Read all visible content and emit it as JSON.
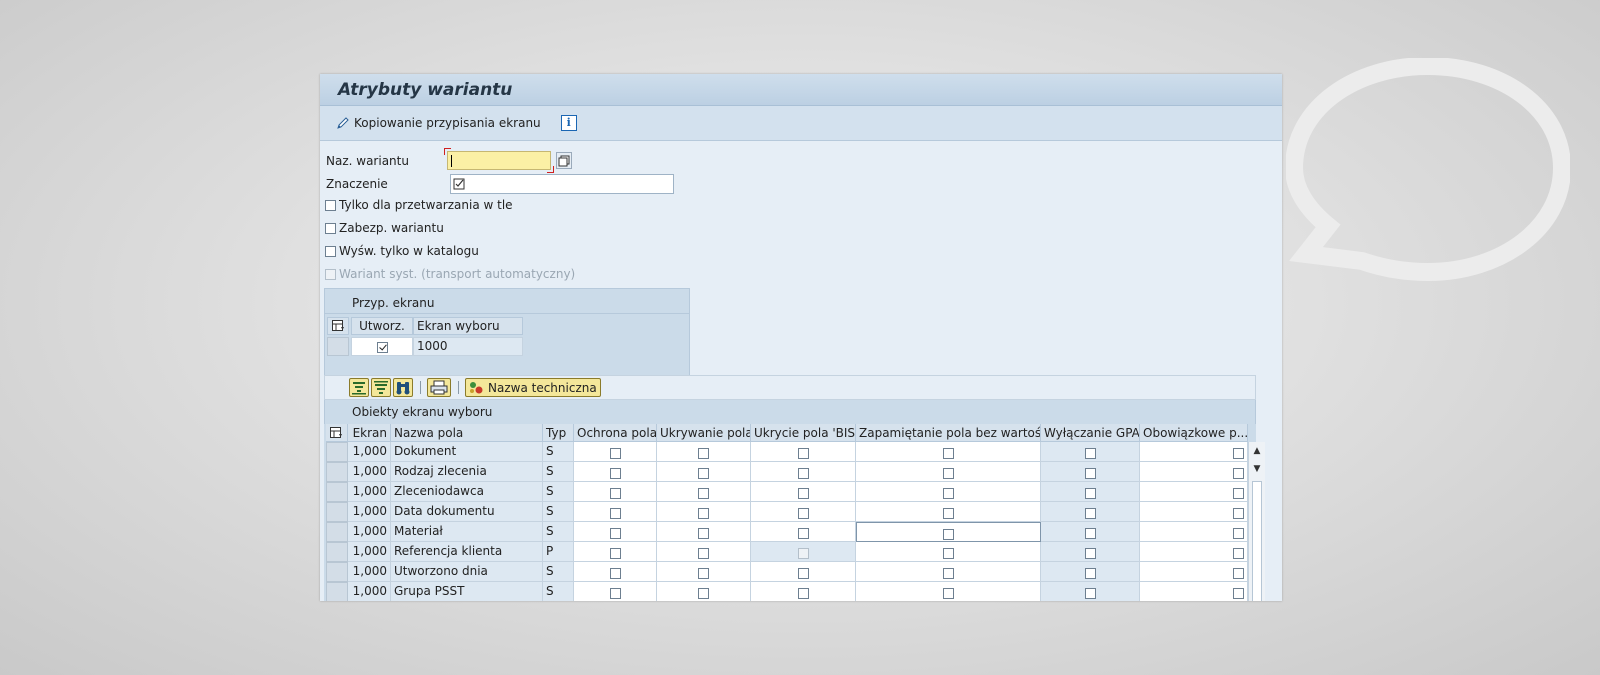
{
  "window": {
    "title": "Atrybuty wariantu"
  },
  "toolbar": {
    "copy_label": "Kopiowanie przypisania ekranu",
    "info_label": "i"
  },
  "form": {
    "variant_name_label": "Naz. wariantu",
    "variant_name_value": "",
    "meaning_label": "Znaczenie",
    "meaning_value": "",
    "options": [
      {
        "label": "Tylko dla przetwarzania w tle",
        "checked": false,
        "disabled": false
      },
      {
        "label": "Zabezp. wariantu",
        "checked": false,
        "disabled": false
      },
      {
        "label": "Wyśw. tylko w katalogu",
        "checked": false,
        "disabled": false
      },
      {
        "label": "Wariant syst. (transport automatyczny)",
        "checked": false,
        "disabled": true
      }
    ]
  },
  "screen_assignment": {
    "title": "Przyp. ekranu",
    "columns": [
      "Utworz.",
      "Ekran wyboru"
    ],
    "rows": [
      {
        "created": true,
        "screen": "1000"
      }
    ]
  },
  "objects_toolbar": {
    "technical_name_label": "Nazwa techniczna"
  },
  "objects": {
    "title": "Obiekty ekranu wyboru",
    "columns": [
      "Ekran",
      "Nazwa pola",
      "Typ",
      "Ochrona pola",
      "Ukrywanie pola",
      "Ukrycie pola 'BIS'",
      "Zapamiętanie pola bez wartości",
      "Wyłączanie GPA",
      "Obowiązkowe p..."
    ],
    "rows": [
      {
        "screen": "1,000",
        "field": "Dokument",
        "type": "S"
      },
      {
        "screen": "1,000",
        "field": "Rodzaj zlecenia",
        "type": "S"
      },
      {
        "screen": "1,000",
        "field": "Zleceniodawca",
        "type": "S"
      },
      {
        "screen": "1,000",
        "field": "Data dokumentu",
        "type": "S"
      },
      {
        "screen": "1,000",
        "field": "Materiał",
        "type": "S"
      },
      {
        "screen": "1,000",
        "field": "Referencja klienta",
        "type": "P"
      },
      {
        "screen": "1,000",
        "field": "Utworzono dnia",
        "type": "S"
      },
      {
        "screen": "1,000",
        "field": "Grupa PSST",
        "type": "S"
      }
    ]
  }
}
